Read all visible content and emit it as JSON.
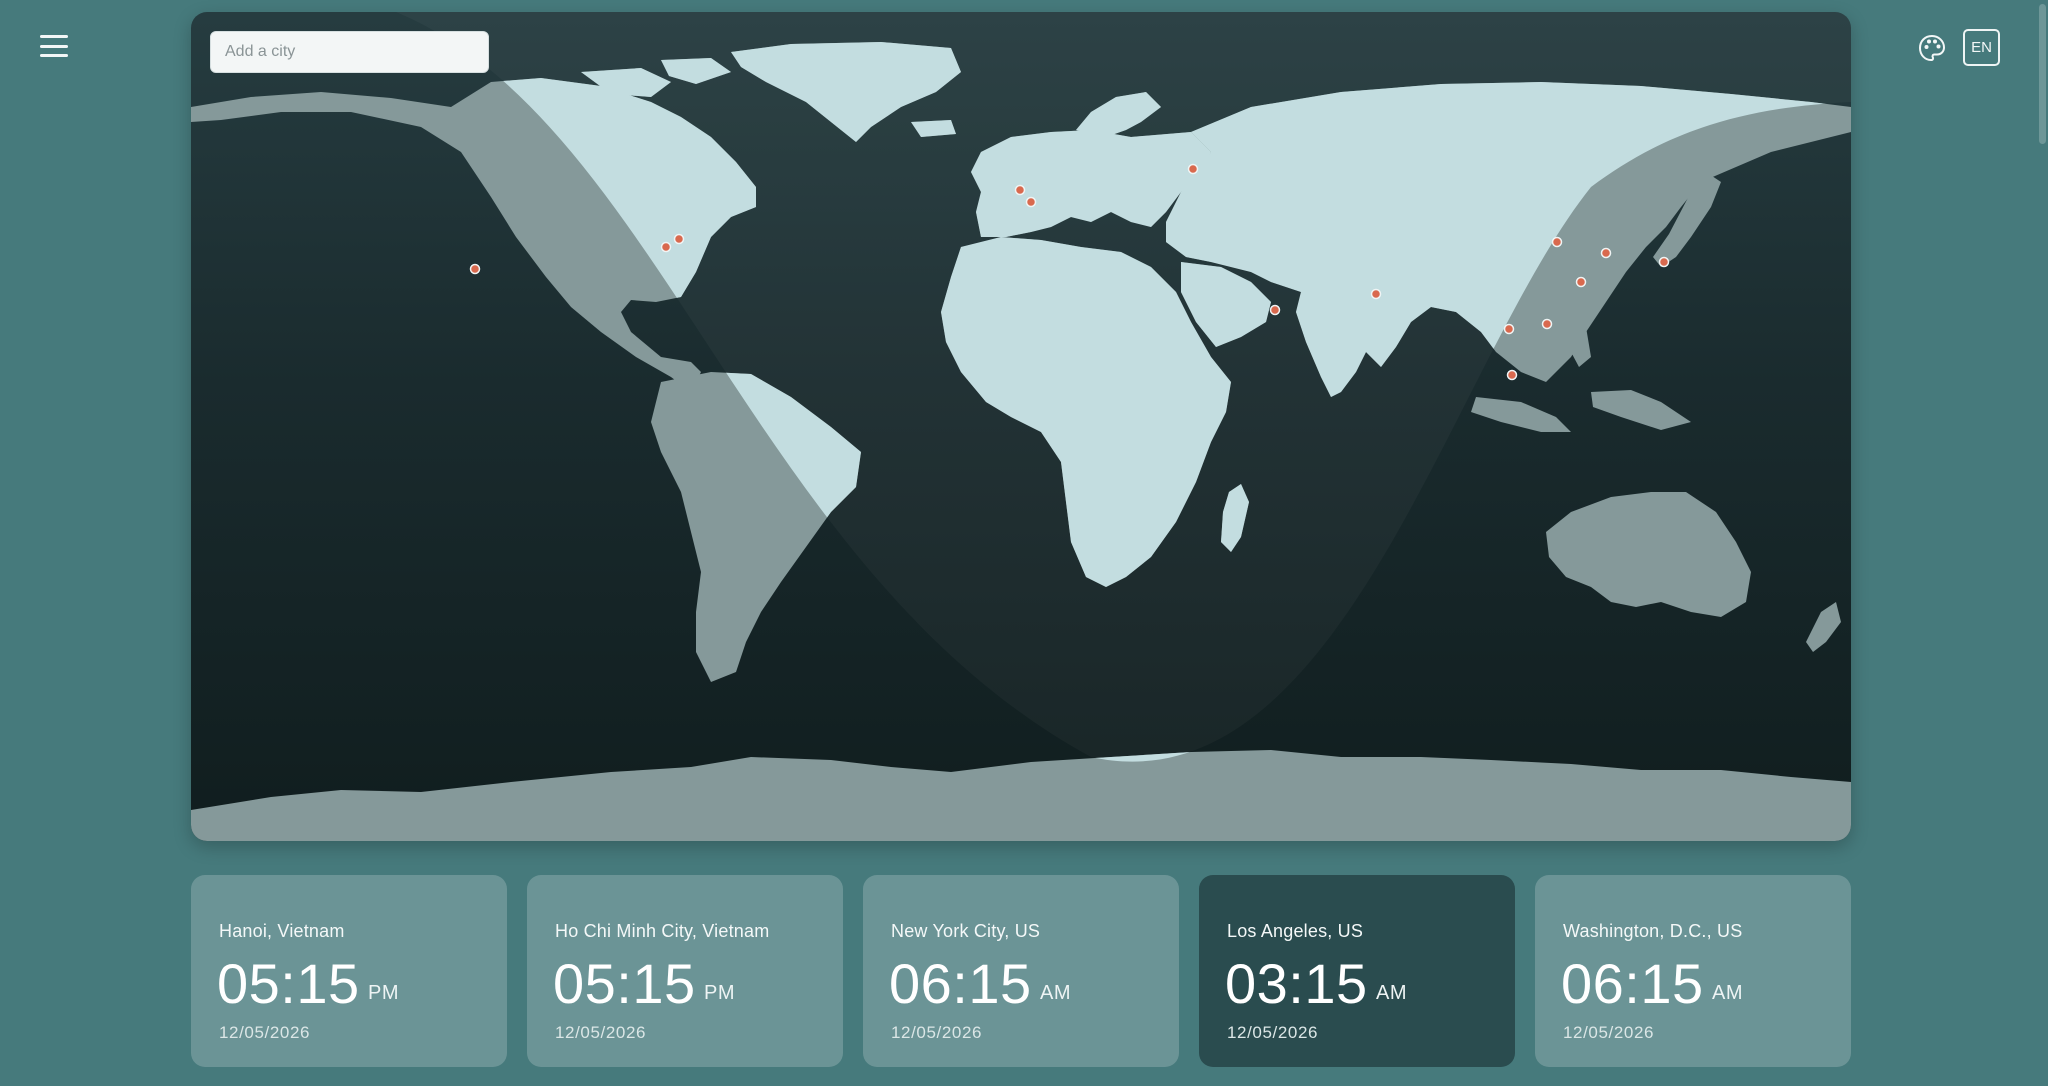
{
  "header": {
    "menu_icon": "hamburger-menu-icon",
    "theme_icon": "palette-icon",
    "language_label": "EN"
  },
  "colors": {
    "background": "#467a7c",
    "map_night": "#101d1e",
    "land_day": "#c3dde0",
    "land_night": "#85999a",
    "city_marker": "#d9694e",
    "card": "rgba(255,255,255,0.2)",
    "card_active": "#2a4c4f"
  },
  "search": {
    "placeholder": "Add a city",
    "value": ""
  },
  "cards": [
    {
      "city": "Hanoi, Vietnam",
      "time": "05:15",
      "ampm": "PM",
      "date": "12/05/2026",
      "active": false
    },
    {
      "city": "Ho Chi Minh City, Vietnam",
      "time": "05:15",
      "ampm": "PM",
      "date": "12/05/2026",
      "active": false
    },
    {
      "city": "New York City, US",
      "time": "06:15",
      "ampm": "AM",
      "date": "12/05/2026",
      "active": false
    },
    {
      "city": "Los Angeles, US",
      "time": "03:15",
      "ampm": "AM",
      "date": "12/05/2026",
      "active": true
    },
    {
      "city": "Washington, D.C., US",
      "time": "06:15",
      "ampm": "AM",
      "date": "12/05/2026",
      "active": false
    }
  ]
}
